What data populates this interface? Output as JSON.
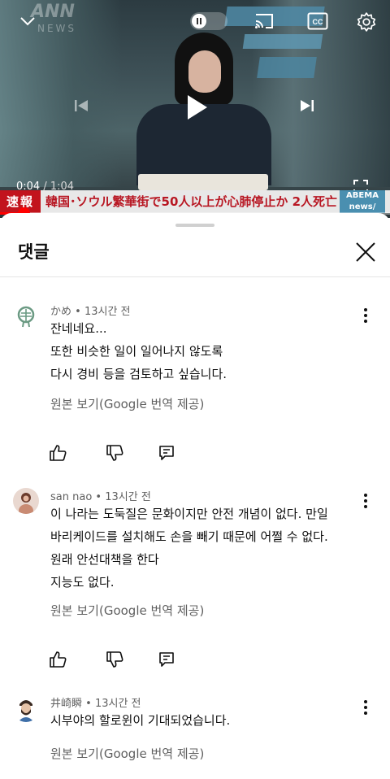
{
  "player": {
    "time_current": "0:04",
    "time_separator": " / ",
    "time_total": "1:04",
    "progress": 0.0625,
    "ticker_label": "速報",
    "ticker_text": "韓国･ソウル繁華街で50人以上が心肺停止か 2人死亡",
    "watermark_text": "ANN",
    "watermark_sub": "NEWS",
    "channel_logo": "ABEMA news/",
    "controls": {
      "collapse": "chevron-down-icon",
      "autoplay": "pause-toggle",
      "cast": "cast-icon",
      "captions": "closed-captions-icon",
      "settings": "gear-icon",
      "previous": "previous-icon",
      "play": "play-icon",
      "next": "next-icon",
      "fullscreen": "fullscreen-icon"
    },
    "accent_color": "#ff0000"
  },
  "sheet": {
    "title": "댓글",
    "close_icon": "close-icon"
  },
  "comments": [
    {
      "author": "かめ",
      "time": "13시간 전",
      "lines": [
        "잔네네요...",
        "또한 비슷한 일이 일어나지 않도록",
        "다시 경비 등을 검토하고 싶습니다."
      ],
      "translate_label": "원본 보기(Google 번역 제공)"
    },
    {
      "author": "san nao",
      "time": "13시간 전",
      "lines": [
        "이 나라는 도둑질은 문화이지만 안전 개념이 없다. 만일",
        "바리케이드를 설치해도 손을 빼기 때문에 어쩔 수 없다.",
        "원래 안선대책을 한다",
        "지능도 없다."
      ],
      "translate_label": "원본 보기(Google 번역 제공)"
    },
    {
      "author": "井崎瞬",
      "time": "13시간 전",
      "lines": [
        "시부야의 할로윈이 기대되었습니다."
      ],
      "translate_label": "원본 보기(Google 번역 제공)"
    }
  ],
  "meta_separator": " • "
}
